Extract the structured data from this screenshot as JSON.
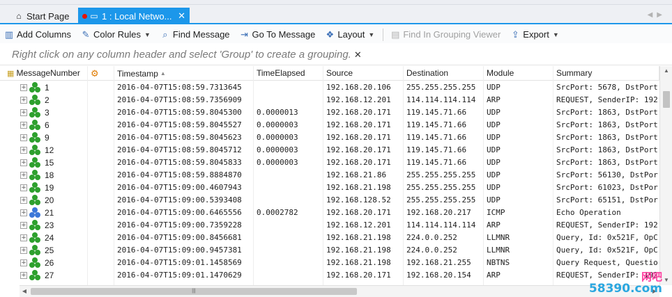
{
  "tabs": [
    {
      "label": "Start Page",
      "active": false
    },
    {
      "label": "1 : Local Netwo...",
      "active": true
    }
  ],
  "toolbar": [
    {
      "label": "Add Columns",
      "icon": "add-columns-icon",
      "glyph": "▥",
      "dropdown": false,
      "enabled": true
    },
    {
      "label": "Color Rules",
      "icon": "color-rules-icon",
      "glyph": "✎",
      "dropdown": true,
      "enabled": true
    },
    {
      "label": "Find Message",
      "icon": "find-message-icon",
      "glyph": "⌕",
      "dropdown": false,
      "enabled": true
    },
    {
      "label": "Go To Message",
      "icon": "go-to-message-icon",
      "glyph": "⇥",
      "dropdown": false,
      "enabled": true
    },
    {
      "label": "Layout",
      "icon": "layout-icon",
      "glyph": "❖",
      "dropdown": true,
      "enabled": true
    },
    {
      "label": "Find In Grouping Viewer",
      "icon": "grouping-viewer-icon",
      "glyph": "▤",
      "dropdown": false,
      "enabled": false
    },
    {
      "label": "Export",
      "icon": "export-icon",
      "glyph": "⇪",
      "dropdown": true,
      "enabled": true
    }
  ],
  "grouping_hint": "Right click on any column header and select 'Group' to create a grouping.",
  "columns": [
    {
      "key": "number",
      "label": "MessageNumber"
    },
    {
      "key": "flag",
      "label": ""
    },
    {
      "key": "timestamp",
      "label": "Timestamp",
      "sorted": "asc"
    },
    {
      "key": "elapsed",
      "label": "TimeElapsed"
    },
    {
      "key": "source",
      "label": "Source"
    },
    {
      "key": "destination",
      "label": "Destination"
    },
    {
      "key": "module",
      "label": "Module"
    },
    {
      "key": "summary",
      "label": "Summary"
    }
  ],
  "rows": [
    {
      "number": "1",
      "icon": "green",
      "timestamp": "2016-04-07T15:08:59.7313645",
      "elapsed": "",
      "source": "192.168.20.106",
      "destination": "255.255.255.255",
      "module": "UDP",
      "summary": "SrcPort: 5678, DstPort"
    },
    {
      "number": "2",
      "icon": "green",
      "timestamp": "2016-04-07T15:08:59.7356909",
      "elapsed": "",
      "source": "192.168.12.201",
      "destination": "114.114.114.114",
      "module": "ARP",
      "summary": "REQUEST, SenderIP: 192"
    },
    {
      "number": "3",
      "icon": "green",
      "timestamp": "2016-04-07T15:08:59.8045300",
      "elapsed": "0.0000013",
      "source": "192.168.20.171",
      "destination": "119.145.71.66",
      "module": "UDP",
      "summary": "SrcPort: 1863, DstPort"
    },
    {
      "number": "6",
      "icon": "green",
      "timestamp": "2016-04-07T15:08:59.8045527",
      "elapsed": "0.0000003",
      "source": "192.168.20.171",
      "destination": "119.145.71.66",
      "module": "UDP",
      "summary": "SrcPort: 1863, DstPort"
    },
    {
      "number": "9",
      "icon": "green",
      "timestamp": "2016-04-07T15:08:59.8045623",
      "elapsed": "0.0000003",
      "source": "192.168.20.171",
      "destination": "119.145.71.66",
      "module": "UDP",
      "summary": "SrcPort: 1863, DstPort"
    },
    {
      "number": "12",
      "icon": "green",
      "timestamp": "2016-04-07T15:08:59.8045712",
      "elapsed": "0.0000003",
      "source": "192.168.20.171",
      "destination": "119.145.71.66",
      "module": "UDP",
      "summary": "SrcPort: 1863, DstPort"
    },
    {
      "number": "15",
      "icon": "green",
      "timestamp": "2016-04-07T15:08:59.8045833",
      "elapsed": "0.0000003",
      "source": "192.168.20.171",
      "destination": "119.145.71.66",
      "module": "UDP",
      "summary": "SrcPort: 1863, DstPort"
    },
    {
      "number": "18",
      "icon": "green",
      "timestamp": "2016-04-07T15:08:59.8884870",
      "elapsed": "",
      "source": "192.168.21.86",
      "destination": "255.255.255.255",
      "module": "UDP",
      "summary": "SrcPort: 56130, DstPor"
    },
    {
      "number": "19",
      "icon": "green",
      "timestamp": "2016-04-07T15:09:00.4607943",
      "elapsed": "",
      "source": "192.168.21.198",
      "destination": "255.255.255.255",
      "module": "UDP",
      "summary": "SrcPort: 61023, DstPor"
    },
    {
      "number": "20",
      "icon": "green",
      "timestamp": "2016-04-07T15:09:00.5393408",
      "elapsed": "",
      "source": "192.168.128.52",
      "destination": "255.255.255.255",
      "module": "UDP",
      "summary": "SrcPort: 65151, DstPor"
    },
    {
      "number": "21",
      "icon": "blue",
      "timestamp": "2016-04-07T15:09:00.6465556",
      "elapsed": "0.0002782",
      "source": "192.168.20.171",
      "destination": "192.168.20.217",
      "module": "ICMP",
      "summary": "Echo Operation"
    },
    {
      "number": "23",
      "icon": "green",
      "timestamp": "2016-04-07T15:09:00.7359228",
      "elapsed": "",
      "source": "192.168.12.201",
      "destination": "114.114.114.114",
      "module": "ARP",
      "summary": "REQUEST, SenderIP: 192"
    },
    {
      "number": "24",
      "icon": "green",
      "timestamp": "2016-04-07T15:09:00.8456681",
      "elapsed": "",
      "source": "192.168.21.198",
      "destination": "224.0.0.252",
      "module": "LLMNR",
      "summary": "Query, Id: 0x521F, OpC"
    },
    {
      "number": "25",
      "icon": "green",
      "timestamp": "2016-04-07T15:09:00.9457381",
      "elapsed": "",
      "source": "192.168.21.198",
      "destination": "224.0.0.252",
      "module": "LLMNR",
      "summary": "Query, Id: 0x521F, OpC"
    },
    {
      "number": "26",
      "icon": "green",
      "timestamp": "2016-04-07T15:09:01.1458569",
      "elapsed": "",
      "source": "192.168.21.198",
      "destination": "192.168.21.255",
      "module": "NBTNS",
      "summary": "Query Request, Questio"
    },
    {
      "number": "27",
      "icon": "green",
      "timestamp": "2016-04-07T15:09:01.1470629",
      "elapsed": "",
      "source": "192.168.20.171",
      "destination": "192.168.20.154",
      "module": "ARP",
      "summary": "REQUEST, SenderIP: 192"
    }
  ],
  "colors": {
    "accent": "#1c97ea",
    "icon_green": "#2da02d",
    "icon_blue": "#3c78d8",
    "dot_red": "#e51400"
  },
  "watermark": {
    "line1": "网吧",
    "line2": "58390.com"
  }
}
